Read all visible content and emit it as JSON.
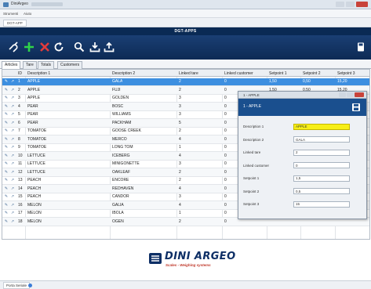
{
  "window": {
    "title": "DiniArgeo"
  },
  "menubar": {
    "items": [
      "Strumenti",
      "Aiuto"
    ]
  },
  "subbar": {
    "tab_label": "DGT-APP"
  },
  "page_title": "DGT-APPS",
  "toolbar": {
    "buttons": [
      {
        "name": "connect-icon",
        "color": "#ffffff"
      },
      {
        "name": "add-icon",
        "color": "#2fd24a"
      },
      {
        "name": "delete-icon",
        "color": "#e23b3b"
      },
      {
        "name": "refresh-icon",
        "color": "#ffffff"
      },
      {
        "name": "search-icon",
        "color": "#ffffff"
      },
      {
        "name": "download-icon",
        "color": "#ffffff"
      },
      {
        "name": "upload-icon",
        "color": "#ffffff"
      },
      {
        "name": "save-icon",
        "color": "#ffffff"
      }
    ]
  },
  "tabs": [
    {
      "label": "Articles",
      "active": true
    },
    {
      "label": "Tare",
      "active": false
    },
    {
      "label": "Totals",
      "active": false
    },
    {
      "label": "Customers",
      "active": false
    }
  ],
  "table": {
    "headers": [
      "ID",
      "Description 1",
      "Description 2",
      "Linked tare",
      "Linked customer",
      "Setpoint 1",
      "Setpoint 2",
      "Setpoint 3"
    ],
    "rows": [
      [
        "1",
        "APPLE",
        "GALA",
        "2",
        "0",
        "1,50",
        "0,50",
        "15,20"
      ],
      [
        "2",
        "APPLE",
        "FUJI",
        "2",
        "0",
        "1,50",
        "0,50",
        "15,20"
      ],
      [
        "3",
        "APPLE",
        "GOLDEN",
        "3",
        "0",
        "",
        "",
        ""
      ],
      [
        "4",
        "PEAR",
        "BOSC",
        "3",
        "0",
        "",
        "",
        ""
      ],
      [
        "5",
        "PEAR",
        "WILLIAMS",
        "3",
        "0",
        "",
        "",
        ""
      ],
      [
        "6",
        "PEAR",
        "PACKHAM",
        "5",
        "0",
        "",
        "",
        ""
      ],
      [
        "7",
        "TOMATOE",
        "GOOSE CREEK",
        "2",
        "0",
        "",
        "",
        ""
      ],
      [
        "8",
        "TOMATOE",
        "MERCO",
        "4",
        "0",
        "",
        "",
        ""
      ],
      [
        "9",
        "TOMATOE",
        "LONG TOM",
        "1",
        "0",
        "",
        "",
        ""
      ],
      [
        "10",
        "LETTUCE",
        "ICEBERG",
        "4",
        "0",
        "",
        "",
        ""
      ],
      [
        "11",
        "LETTUCE",
        "MINIGONETTE",
        "3",
        "0",
        "",
        "",
        ""
      ],
      [
        "12",
        "LETTUCE",
        "OAKLEAF",
        "2",
        "0",
        "",
        "",
        ""
      ],
      [
        "13",
        "PEACH",
        "ENCORE",
        "2",
        "0",
        "",
        "",
        ""
      ],
      [
        "14",
        "PEACH",
        "REDHAVEN",
        "4",
        "0",
        "",
        "",
        ""
      ],
      [
        "15",
        "PEACH",
        "CANDOR",
        "3",
        "0",
        "",
        "",
        ""
      ],
      [
        "16",
        "MELON",
        "GALIA",
        "4",
        "0",
        "",
        "",
        ""
      ],
      [
        "17",
        "MELON",
        "IBOLA",
        "1",
        "0",
        "",
        "",
        ""
      ],
      [
        "18",
        "MELON",
        "OGEN",
        "2",
        "0",
        "",
        "",
        ""
      ]
    ],
    "selected_row": 0
  },
  "dialog": {
    "title": "1 - APPLE",
    "header": "1 - APPLE",
    "fields": [
      {
        "label": "Description 1",
        "value": "APPLE",
        "highlight": true
      },
      {
        "label": "Description 2",
        "value": "GALA",
        "highlight": false
      },
      {
        "label": "Linked tare",
        "value": "2",
        "highlight": false
      },
      {
        "label": "Linked customer",
        "value": "0",
        "highlight": false
      },
      {
        "label": "Setpoint 1",
        "value": "1,5",
        "highlight": false
      },
      {
        "label": "Setpoint 2",
        "value": "0,5",
        "highlight": false
      },
      {
        "label": "Setpoint 3",
        "value": "15",
        "highlight": false
      }
    ]
  },
  "logo": {
    "brand": "DINI ARGEO",
    "tagline": "Scales - Weighing systems"
  },
  "statusbar": {
    "label": "Porta Seriale"
  }
}
